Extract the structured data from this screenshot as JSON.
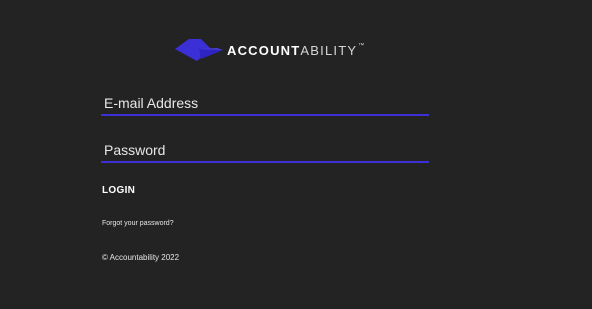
{
  "brand": {
    "name_strong": "ACCOUNT",
    "name_light": "ABILITY",
    "trademark": "™",
    "accent_color": "#3b2fd6",
    "logo_icon": "diamond-chevron-logo-icon"
  },
  "login_form": {
    "email_placeholder": "E-mail Address",
    "email_value": "",
    "password_placeholder": "Password",
    "password_value": "",
    "submit_label": "LOGIN",
    "forgot_password_label": "Forgot your password?"
  },
  "footer": {
    "copyright": "© Accountability 2022"
  }
}
